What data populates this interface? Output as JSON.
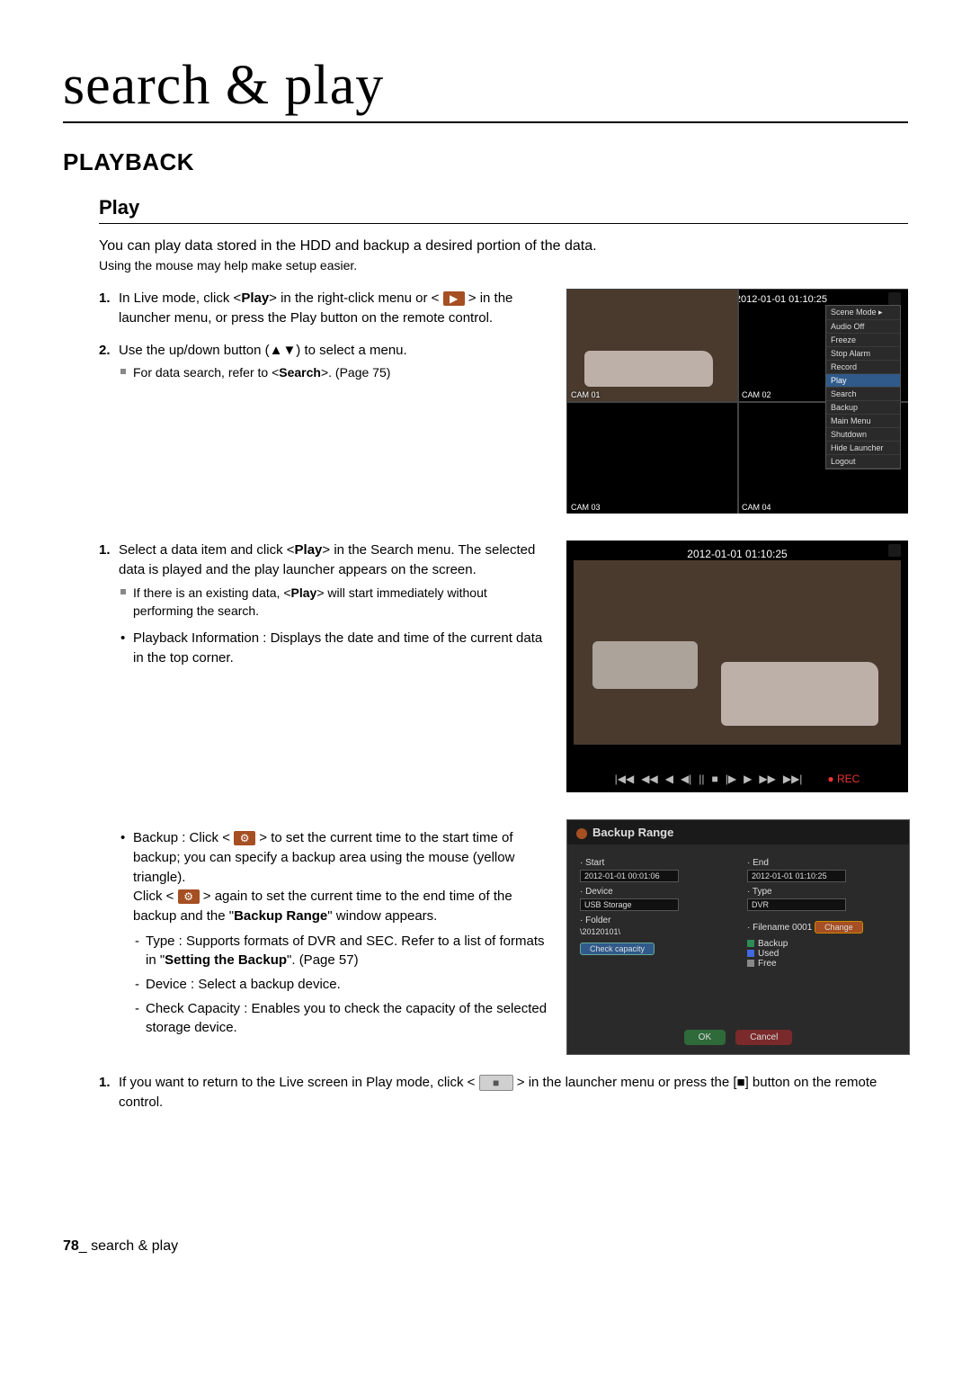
{
  "chapterTitle": "search & play",
  "h1": "PLAYBACK",
  "h2": "Play",
  "intro": "You can play data stored in the HDD and backup a desired portion of the data.",
  "introSub": "Using the mouse may help make setup easier.",
  "step1a": "In Live mode, click <",
  "step1Play": "Play",
  "step1b": "> in the right-click menu or < ",
  "step1c": " > in the launcher menu, or press the Play button on the remote control.",
  "step2": "Use the up/down button (▲▼) to select a menu.",
  "step2sub_a": "For data search, refer to <",
  "step2sub_search": "Search",
  "step2sub_b": ">. (Page 75)",
  "step3a": "Select a data item and click <",
  "step3Play": "Play",
  "step3b": "> in the Search menu. The selected data is played and the play launcher appears on the screen.",
  "step3sub_a": "If there is an existing data, <",
  "step3sub_play": "Play",
  "step3sub_b": "> will start immediately without performing the search.",
  "bulletPlayback": "Playback Information : Displays the date and time of the current data in the top corner.",
  "bulletBackup_a": "Backup : Click < ",
  "bulletBackup_b": " > to set the current time to the start time of backup; you can specify a backup area using the mouse (yellow triangle).",
  "bulletBackup_c": "Click < ",
  "bulletBackup_d": " > again to set the current time to the end time of the backup and the \"",
  "bulletBackup_bold": "Backup Range",
  "bulletBackup_e": "\" window appears.",
  "dashType_a": "Type : Supports formats of DVR and SEC. Refer to a list of formats in \"",
  "dashType_bold": "Setting the Backup",
  "dashType_b": "\". (Page 57)",
  "dashDevice": "Device : Select a backup device.",
  "dashCapacity": "Check Capacity : Enables you to check the capacity of the selected storage device.",
  "step4a": "If you want to return to the Live screen in Play mode, click < ",
  "step4b": " > in the launcher menu or press the [",
  "step4c": "] button on the remote control.",
  "stopSymbol": "■",
  "triSymbol": "▶",
  "gearSymbol": "⚙",
  "screenshot1": {
    "timestamp": "2012-01-01 01:10:25",
    "cams": [
      "CAM 01",
      "CAM 02",
      "CAM 03",
      "CAM 04"
    ],
    "menu": [
      "Scene Mode  ▸",
      "Audio Off",
      "Freeze",
      "Stop Alarm",
      "Record",
      "Play",
      "Search",
      "Backup",
      "Main Menu",
      "Shutdown",
      "Hide Launcher",
      "Logout"
    ],
    "menuHighlightIdx": 5
  },
  "screenshot2": {
    "timestamp": "2012-01-01 01:10:25",
    "rec": "● REC",
    "controls": [
      "|◀◀",
      "◀◀",
      "◀",
      "◀|",
      "||",
      "■",
      "|▶",
      "▶",
      "▶▶",
      "▶▶|"
    ]
  },
  "backupWin": {
    "title": "Backup Range",
    "start": {
      "label": "· Start",
      "value": "2012-01-01 00:01:06"
    },
    "end": {
      "label": "· End",
      "value": "2012-01-01 01:10:25"
    },
    "device": {
      "label": "· Device",
      "value": "USB Storage"
    },
    "type": {
      "label": "· Type",
      "value": "DVR"
    },
    "folder": {
      "label": "· Folder",
      "value": "\\20120101\\"
    },
    "filename": {
      "label": "· Filename",
      "value": "0001"
    },
    "check": "Check capacity",
    "change": "Change",
    "legend": [
      {
        "color": "#2e8b57",
        "label": "Backup"
      },
      {
        "color": "#4169e1",
        "label": "Used"
      },
      {
        "color": "#888888",
        "label": "Free"
      }
    ],
    "ok": "OK",
    "cancel": "Cancel"
  },
  "footer": {
    "page": "78",
    "sep": "_",
    "section": "search & play"
  }
}
